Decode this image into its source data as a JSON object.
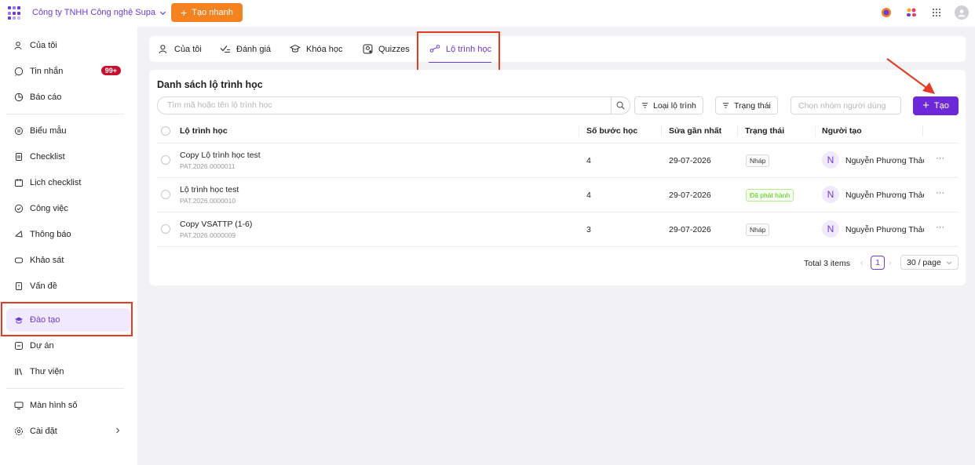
{
  "topbar": {
    "company": "Công ty TNHH Công nghệ Supa",
    "quick_create_label": "Tạo nhanh",
    "icons": [
      "notification-icon",
      "team-icon",
      "apps-grid-icon",
      "user-avatar-icon"
    ]
  },
  "sidebar": {
    "items": [
      {
        "label": "Của tôi",
        "icon": "user-icon"
      },
      {
        "label": "Tin nhắn",
        "icon": "chat-icon",
        "badge": "99+"
      },
      {
        "label": "Báo cáo",
        "icon": "report-icon"
      },
      {
        "label": "Biểu mẫu",
        "icon": "form-icon"
      },
      {
        "label": "Checklist",
        "icon": "checklist-icon"
      },
      {
        "label": "Lịch checklist",
        "icon": "calendar-checklist-icon"
      },
      {
        "label": "Công việc",
        "icon": "task-icon"
      },
      {
        "label": "Thông báo",
        "icon": "announcement-icon"
      },
      {
        "label": "Khảo sát",
        "icon": "survey-icon"
      },
      {
        "label": "Vấn đề",
        "icon": "issue-icon"
      },
      {
        "label": "Đào tạo",
        "icon": "training-icon",
        "active": true
      },
      {
        "label": "Dự án",
        "icon": "project-icon"
      },
      {
        "label": "Thư viện",
        "icon": "library-icon"
      },
      {
        "label": "Màn hình số",
        "icon": "monitor-icon"
      },
      {
        "label": "Cài đặt",
        "icon": "settings-icon"
      }
    ]
  },
  "tabs": [
    {
      "label": "Của tôi",
      "icon": "user-icon"
    },
    {
      "label": "Đánh giá",
      "icon": "evaluation-icon"
    },
    {
      "label": "Khóa học",
      "icon": "graduation-cap-icon"
    },
    {
      "label": "Quizzes",
      "icon": "quiz-icon"
    },
    {
      "label": "Lộ trình học",
      "icon": "path-icon",
      "active": true
    }
  ],
  "list": {
    "title": "Danh sách lộ trình học",
    "search_placeholder": "Tìm mã hoặc tên lộ trình học",
    "filter_type_label": "Loại lộ trình",
    "filter_status_label": "Trạng thái",
    "user_group_placeholder": "Chọn nhóm người dùng",
    "create_label": "Tạo",
    "columns": [
      "Lộ trình học",
      "Số bước học",
      "Sửa gần nhất",
      "Trạng thái",
      "Người tạo"
    ],
    "rows": [
      {
        "name": "Copy Lộ trình học test",
        "code": "PAT.2026.0000011",
        "steps": "4",
        "modified": "29-07-2026",
        "status": "Nháp",
        "status_type": "draft",
        "creator_initial": "N",
        "creator": "Nguyễn Phương Thảo"
      },
      {
        "name": "Lộ trình học test",
        "code": "PAT.2026.0000010",
        "steps": "4",
        "modified": "29-07-2026",
        "status": "Đã phát hành",
        "status_type": "published",
        "creator_initial": "N",
        "creator": "Nguyễn Phương Thảo"
      },
      {
        "name": "Copy VSATTP (1-6)",
        "code": "PAT.2026.0000009",
        "steps": "3",
        "modified": "29-07-2026",
        "status": "Nháp",
        "status_type": "draft",
        "creator_initial": "N",
        "creator": "Nguyễn Phương Thảo"
      }
    ],
    "more_label": "···",
    "pagination": {
      "total": "Total 3 items",
      "current_page": "1",
      "page_size": "30 / page"
    }
  },
  "colors": {
    "brand": "#6d3bd6",
    "primary_button": "#6d28d9",
    "quick_button": "#f58220",
    "highlight": "#e53b25",
    "published": "#52c41a"
  }
}
